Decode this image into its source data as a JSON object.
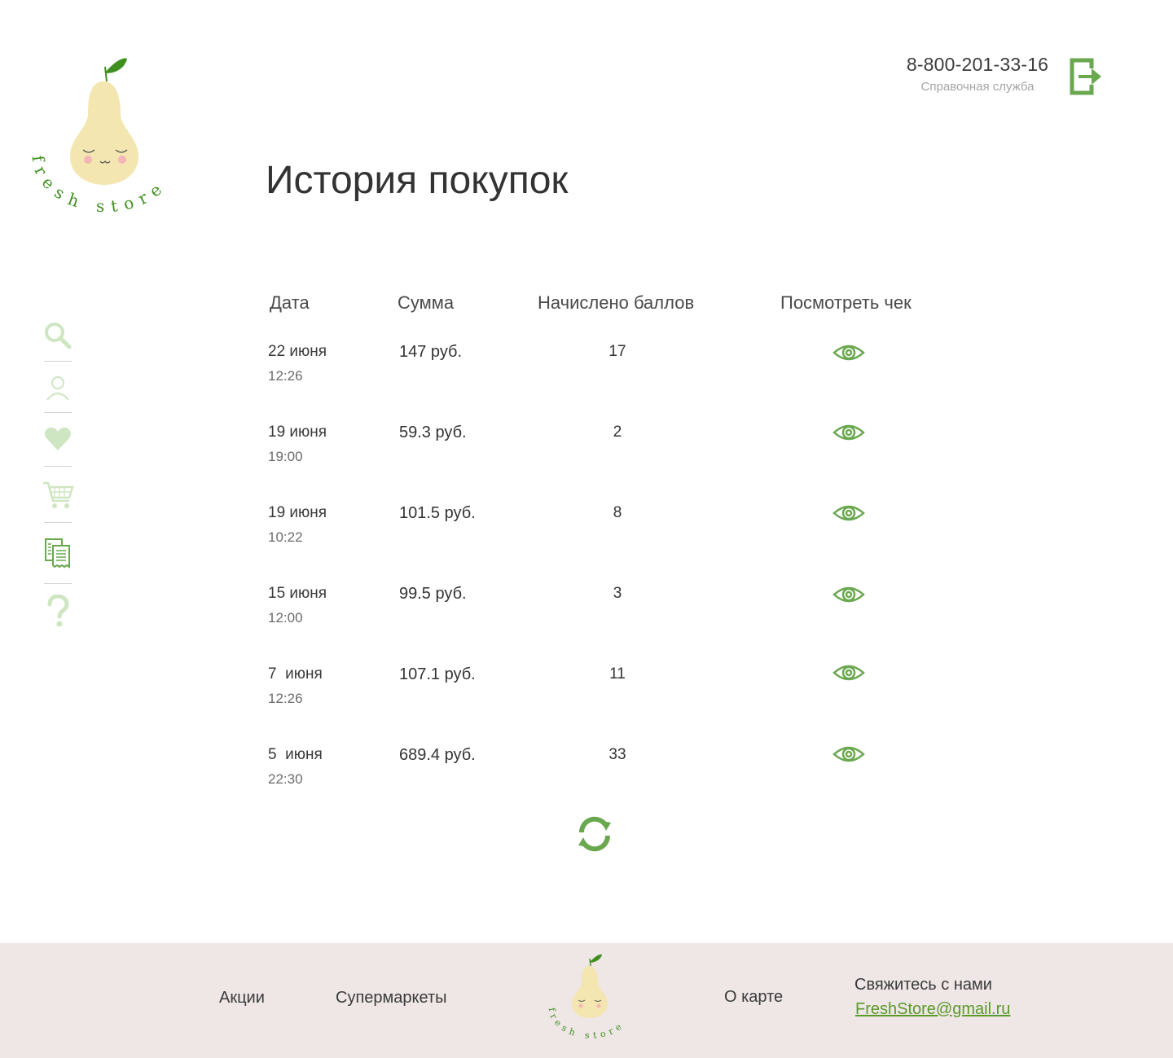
{
  "header": {
    "phone": "8-800-201-33-16",
    "phone_caption": "Справочная служба",
    "logo_text": "fresh store"
  },
  "page_title": "История покупок",
  "sidebar": {
    "icons": [
      "search-icon",
      "user-icon",
      "heart-icon",
      "cart-icon",
      "receipts-icon",
      "help-icon"
    ]
  },
  "table": {
    "headers": [
      "Дата",
      "Сумма",
      "Начислено баллов",
      "Посмотреть чек"
    ],
    "rows": [
      {
        "date": "22 июня",
        "time": "12:26",
        "sum": "147 руб.",
        "points": "17"
      },
      {
        "date": "19 июня",
        "time": "19:00",
        "sum": "59.3 руб.",
        "points": "2"
      },
      {
        "date": "19 июня",
        "time": "10:22",
        "sum": "101.5 руб.",
        "points": "8"
      },
      {
        "date": "15 июня",
        "time": "12:00",
        "sum": "99.5 руб.",
        "points": "3"
      },
      {
        "date": "7  июня",
        "time": "12:26",
        "sum": "107.1 руб.",
        "points": "11"
      },
      {
        "date": "5  июня",
        "time": "22:30",
        "sum": "689.4 руб.",
        "points": "33"
      }
    ]
  },
  "footer": {
    "links": [
      "Акции",
      "Супермаркеты",
      "О карте"
    ],
    "contact_label": "Свяжитесь с нами",
    "email": "FreshStore@gmail.ru"
  },
  "colors": {
    "accent_green": "#6aa84f",
    "light_green": "#cfe6c2",
    "pear": "#f4e6b0",
    "leaf": "#3f8f1f",
    "footer_bg": "#efe6e6"
  }
}
